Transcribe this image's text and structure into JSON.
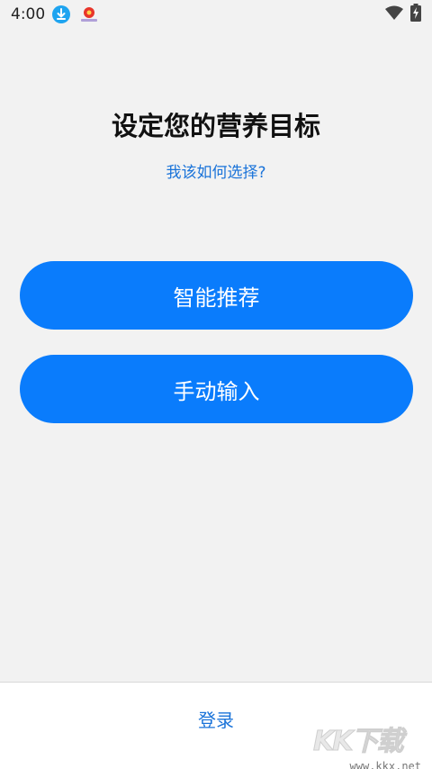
{
  "status_bar": {
    "time": "4:00",
    "icons": [
      "download-icon",
      "app-notification-icon",
      "wifi-icon",
      "battery-charging-icon"
    ]
  },
  "header": {
    "title": "设定您的营养目标",
    "help_link": "我该如何选择?"
  },
  "options": {
    "smart_label": "智能推荐",
    "manual_label": "手动输入"
  },
  "footer": {
    "login_label": "登录"
  },
  "watermark": {
    "logo": "KK下载",
    "url": "www.kkx.net"
  },
  "colors": {
    "accent": "#0a7cfc",
    "link": "#1a73d9",
    "background": "#f2f2f2"
  }
}
